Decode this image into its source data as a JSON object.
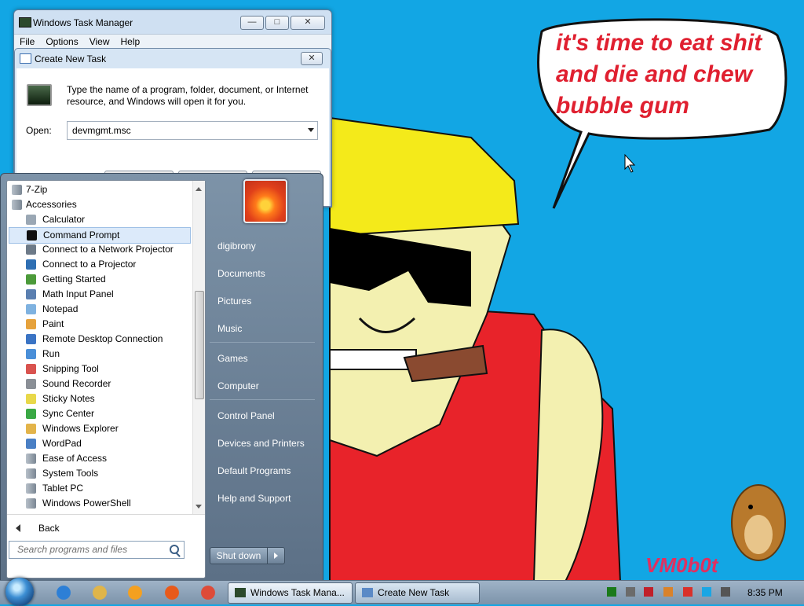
{
  "desktop": {
    "speech_bubble_lines": [
      "it's time to eat shit",
      "and die and chew",
      "bubble gum"
    ],
    "watermark": "VM0b0t"
  },
  "task_manager": {
    "title": "Windows Task Manager",
    "menu": [
      "File",
      "Options",
      "View",
      "Help"
    ],
    "caption_buttons": {
      "minimize": "—",
      "maximize": "□",
      "close": "✕"
    }
  },
  "create_task": {
    "title": "Create New Task",
    "description": "Type the name of a program, folder, document, or Internet resource, and Windows will open it for you.",
    "open_label": "Open:",
    "open_value": "devmgmt.msc",
    "close_glyph": "✕"
  },
  "start_menu": {
    "programs": [
      {
        "label": "7-Zip",
        "kind": "folder"
      },
      {
        "label": "Accessories",
        "kind": "folder"
      },
      {
        "label": "Calculator",
        "kind": "item",
        "icon": "calculator-icon",
        "color": "#9aa7b4"
      },
      {
        "label": "Command Prompt",
        "kind": "item",
        "icon": "command-prompt-icon",
        "color": "#111111",
        "highlighted": true
      },
      {
        "label": "Connect to a Network Projector",
        "kind": "item",
        "icon": "network-projector-icon",
        "color": "#6d7a88"
      },
      {
        "label": "Connect to a Projector",
        "kind": "item",
        "icon": "projector-icon",
        "color": "#2f6fb3"
      },
      {
        "label": "Getting Started",
        "kind": "item",
        "icon": "getting-started-icon",
        "color": "#4c9a3a"
      },
      {
        "label": "Math Input Panel",
        "kind": "item",
        "icon": "math-input-icon",
        "color": "#5a7fb0"
      },
      {
        "label": "Notepad",
        "kind": "item",
        "icon": "notepad-icon",
        "color": "#7fb2e0"
      },
      {
        "label": "Paint",
        "kind": "item",
        "icon": "paint-icon",
        "color": "#e6a23c"
      },
      {
        "label": "Remote Desktop Connection",
        "kind": "item",
        "icon": "remote-desktop-icon",
        "color": "#3b74c4"
      },
      {
        "label": "Run",
        "kind": "item",
        "icon": "run-icon",
        "color": "#4a8fd8"
      },
      {
        "label": "Snipping Tool",
        "kind": "item",
        "icon": "snipping-tool-icon",
        "color": "#d9534f"
      },
      {
        "label": "Sound Recorder",
        "kind": "item",
        "icon": "sound-recorder-icon",
        "color": "#8a8f96"
      },
      {
        "label": "Sticky Notes",
        "kind": "item",
        "icon": "sticky-notes-icon",
        "color": "#e8d84a"
      },
      {
        "label": "Sync Center",
        "kind": "item",
        "icon": "sync-center-icon",
        "color": "#3aa845"
      },
      {
        "label": "Windows Explorer",
        "kind": "item",
        "icon": "windows-explorer-icon",
        "color": "#e3b44a"
      },
      {
        "label": "WordPad",
        "kind": "item",
        "icon": "wordpad-icon",
        "color": "#4a7fc4"
      },
      {
        "label": "Ease of Access",
        "kind": "subfolder"
      },
      {
        "label": "System Tools",
        "kind": "subfolder"
      },
      {
        "label": "Tablet PC",
        "kind": "subfolder"
      },
      {
        "label": "Windows PowerShell",
        "kind": "subfolder"
      }
    ],
    "back_label": "Back",
    "search_placeholder": "Search programs and files",
    "right_links": [
      "digibrony",
      "Documents",
      "Pictures",
      "Music",
      "Games",
      "Computer",
      "Control Panel",
      "Devices and Printers",
      "Default Programs",
      "Help and Support"
    ],
    "shutdown_label": "Shut down"
  },
  "taskbar": {
    "pinned": [
      "internet-explorer-icon",
      "windows-explorer-icon",
      "media-player-icon",
      "firefox-icon",
      "chrome-icon"
    ],
    "tasks": [
      {
        "label": "Windows Task Mana...",
        "active": true
      },
      {
        "label": "Create New Task",
        "active": false
      }
    ],
    "tray_icons": [
      "green-square-icon",
      "network-icon",
      "antivirus-v-icon",
      "search-tray-icon",
      "flag-icon",
      "display-icon",
      "volume-icon"
    ],
    "clock": "8:35 PM"
  },
  "colors": {
    "desktop_bg": "#12a6e4",
    "start_menu": "#6b8096",
    "highlight": "#dceafa",
    "bubble_text": "#e02030"
  }
}
